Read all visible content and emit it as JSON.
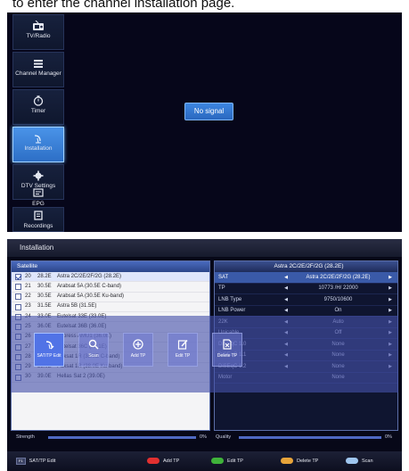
{
  "caption": "to enter the channel installation page.",
  "screen1": {
    "menu": [
      {
        "label": "TV/Radio",
        "icon": "tv-radio-icon"
      },
      {
        "label": "Channel Manager",
        "icon": "list-icon"
      },
      {
        "label": "Timer",
        "icon": "timer-icon"
      },
      {
        "label": "Installation",
        "icon": "satellite-dish-icon",
        "active": true
      },
      {
        "label": "DTV Settings",
        "icon": "gear-icon"
      },
      {
        "label": "EPG",
        "icon": "epg-icon"
      },
      {
        "label": "Recordings",
        "icon": "recordings-icon"
      }
    ],
    "no_signal": "No signal"
  },
  "screen2": {
    "title": "Installation",
    "satellite_header": "Satellite",
    "satellites": [
      {
        "num": "20",
        "pos": "28.2E",
        "name": "Astra 2C/2E/2F/2G (28.2E)",
        "checked": true,
        "selected": true
      },
      {
        "num": "21",
        "pos": "30.5E",
        "name": "Arabsat 5A (30.5E C-band)",
        "checked": false
      },
      {
        "num": "22",
        "pos": "30.5E",
        "name": "Arabsat 5A (30.5E Ku-band)",
        "checked": false
      },
      {
        "num": "23",
        "pos": "31.5E",
        "name": "Astra 5B (31.5E)",
        "checked": false
      },
      {
        "num": "24",
        "pos": "33.0E",
        "name": "Eutelsat 33E (33.0E)",
        "checked": false
      },
      {
        "num": "25",
        "pos": "36.0E",
        "name": "Eutelsat 36B (36.0E)",
        "checked": false
      },
      {
        "num": "26",
        "pos": "36.0E",
        "name": "Express AMU1 (36.0E)",
        "checked": false
      },
      {
        "num": "27",
        "pos": "36.1E",
        "name": "Eutelsat 36C (36.1E)",
        "checked": false
      },
      {
        "num": "28",
        "pos": "38.0E",
        "name": "Paksat 1R (38.0E C-band)",
        "checked": false
      },
      {
        "num": "29",
        "pos": "38.0E",
        "name": "Paksat 1R (38.0E Ku-band)",
        "checked": false
      },
      {
        "num": "30",
        "pos": "39.0E",
        "name": "Hellas Sat 2 (39.0E)",
        "checked": false
      }
    ],
    "param_header": "Astra 2C/2E/2F/2G (28.2E)",
    "params": [
      {
        "label": "SAT",
        "value": "Astra 2C/2E/2F/2G (28.2E)",
        "arrows": true,
        "selected": true
      },
      {
        "label": "TP",
        "value": "10773 /H/ 22000",
        "arrows": true
      },
      {
        "label": "LNB Type",
        "value": "9750/10600",
        "arrows": true
      },
      {
        "label": "LNB Power",
        "value": "On",
        "arrows": true
      },
      {
        "label": "22K",
        "value": "Auto",
        "arrows": true
      },
      {
        "label": "Unicable",
        "value": "Off",
        "arrows": true
      },
      {
        "label": "DiSEqC 1.0",
        "value": "None",
        "arrows": true
      },
      {
        "label": "DiSEqC 1.1",
        "value": "None",
        "arrows": true
      },
      {
        "label": "DiSEqC 1.2",
        "value": "None",
        "arrows": true
      },
      {
        "label": "Motor",
        "value": "None",
        "arrows": false
      }
    ],
    "tools": [
      {
        "label": "SAT/TP Edit",
        "icon": "satellite-edit-icon",
        "focus": true
      },
      {
        "label": "Scan",
        "icon": "search-icon"
      },
      {
        "label": "Add TP",
        "icon": "add-circle-icon"
      },
      {
        "label": "Edit TP",
        "icon": "edit-icon"
      },
      {
        "label": "Delete TP",
        "icon": "delete-file-icon"
      }
    ],
    "strength_label": "Strength",
    "strength_value": "0%",
    "quality_label": "Quality",
    "quality_value": "0%",
    "bottom": {
      "key": "F1",
      "sat_tp_edit": "SAT/TP Edit",
      "add_tp": "Add TP",
      "edit_tp": "Edit TP",
      "delete_tp": "Delete TP",
      "scan": "Scan",
      "colors": {
        "red": "#e23030",
        "green": "#3fb23a",
        "yellow": "#e7a43a",
        "blue": "#9fc6ef"
      }
    }
  }
}
